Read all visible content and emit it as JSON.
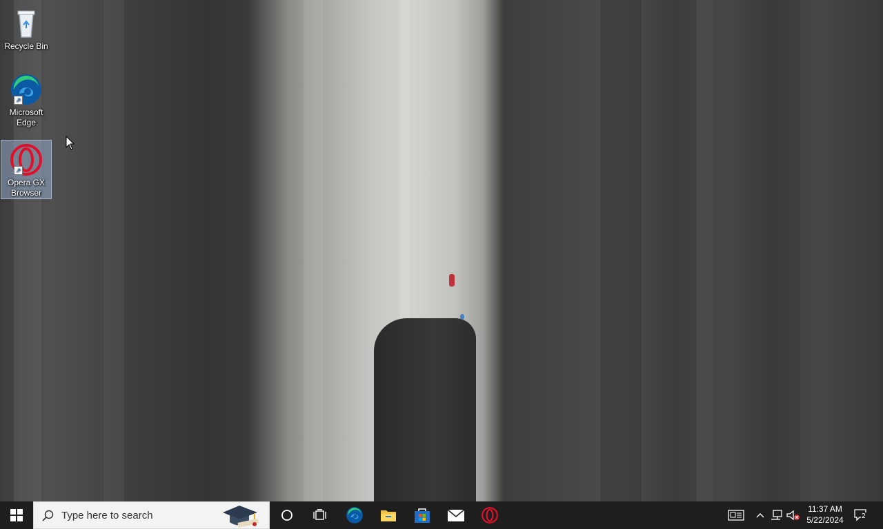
{
  "desktop": {
    "icons": [
      {
        "label": "Recycle Bin",
        "icon": "recycle-bin-icon"
      },
      {
        "label": "Microsoft Edge",
        "icon": "edge-icon"
      },
      {
        "label": "Opera GX Browser",
        "icon": "opera-gx-icon"
      }
    ]
  },
  "taskbar": {
    "search_placeholder": "Type here to search",
    "pinned": [
      "Cortana",
      "Task View",
      "Microsoft Edge",
      "File Explorer",
      "Microsoft Store",
      "Mail",
      "Opera GX Browser"
    ],
    "clock": {
      "time": "11:37 AM",
      "date": "5/22/2024"
    },
    "notification_count": "2"
  },
  "colors": {
    "taskbar_bg": "#1e1e1e",
    "search_bg": "#f3f3f3",
    "accent_windows": "#0078d7",
    "opera_red": "#e0102a"
  }
}
